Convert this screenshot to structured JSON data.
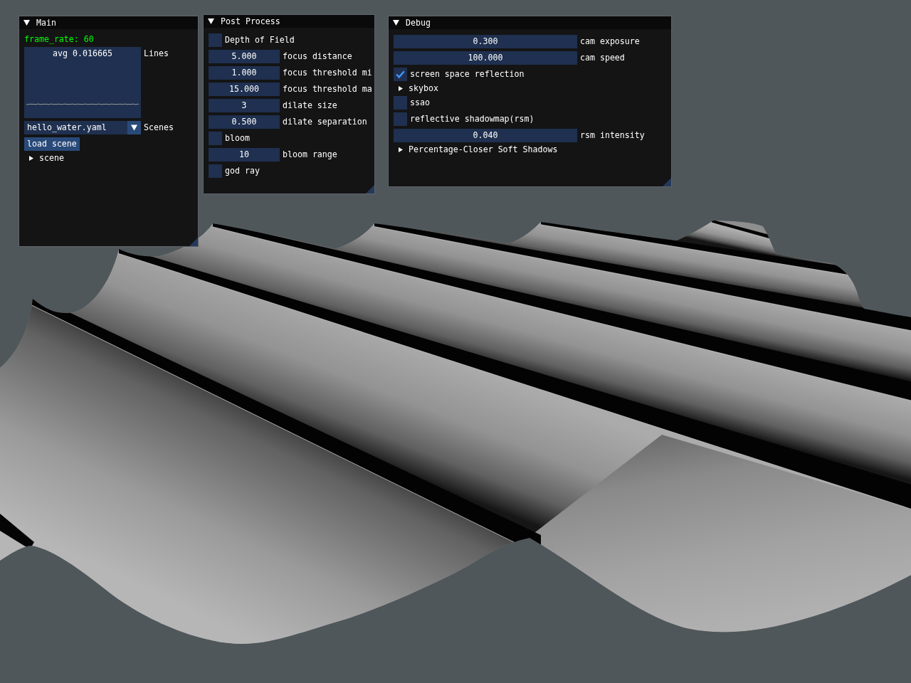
{
  "windows": [
    {
      "title": "Main",
      "expanded": true,
      "items": [
        {
          "kind": "colored_text",
          "text": "frame_rate: 60"
        },
        {
          "kind": "plot",
          "overlay": "avg 0.016665",
          "label": "Lines"
        },
        {
          "kind": "combo",
          "label": "Scenes",
          "field": {
            "value": "hello_water.yaml"
          }
        },
        {
          "kind": "button",
          "label": "load scene"
        },
        {
          "kind": "tree_node",
          "label": "scene",
          "expanded": false
        }
      ]
    },
    {
      "title": "Post Process",
      "expanded": true,
      "items": [
        {
          "kind": "checkbox",
          "label": "Depth of Field",
          "checked": false
        },
        {
          "kind": "drag",
          "label": "focus distance",
          "field": {
            "value": "5.000"
          }
        },
        {
          "kind": "drag",
          "label": "focus threshold mi",
          "field": {
            "value": "1.000"
          }
        },
        {
          "kind": "drag",
          "label": "focus threshold ma",
          "field": {
            "value": "15.000"
          }
        },
        {
          "kind": "drag",
          "label": "dilate size",
          "field": {
            "value": "3"
          }
        },
        {
          "kind": "drag",
          "label": "dilate separation",
          "field": {
            "value": "0.500"
          }
        },
        {
          "kind": "checkbox",
          "label": "bloom",
          "checked": false
        },
        {
          "kind": "drag",
          "label": "bloom range",
          "field": {
            "value": "10"
          }
        },
        {
          "kind": "checkbox",
          "label": "god ray",
          "checked": false
        }
      ]
    },
    {
      "title": "Debug",
      "expanded": true,
      "items": [
        {
          "kind": "drag",
          "label": "cam exposure",
          "field": {
            "value": "0.300"
          }
        },
        {
          "kind": "drag",
          "label": "cam speed",
          "field": {
            "value": "100.000"
          }
        },
        {
          "kind": "checkbox",
          "label": "screen space reflection",
          "checked": true
        },
        {
          "kind": "tree_node",
          "label": "skybox",
          "expanded": false
        },
        {
          "kind": "checkbox",
          "label": "ssao",
          "checked": false
        },
        {
          "kind": "checkbox",
          "label": "reflective shadowmap(rsm)",
          "checked": false
        },
        {
          "kind": "drag",
          "label": "rsm intensity",
          "field": {
            "value": "0.040"
          }
        },
        {
          "kind": "tree_node",
          "label": "Percentage-Closer Soft Shadows",
          "expanded": false
        }
      ]
    }
  ]
}
